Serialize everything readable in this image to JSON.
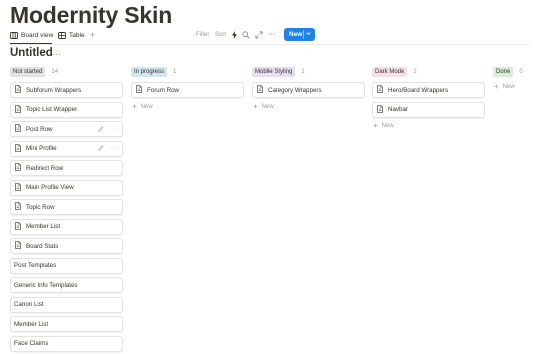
{
  "page": {
    "title": "Modernity Skin"
  },
  "toolbar": {
    "tabs": [
      {
        "label": "Board view",
        "active": true
      },
      {
        "label": "Table",
        "active": false
      }
    ],
    "add_tab": "+",
    "filter_label": "Filter",
    "sort_label": "Sort",
    "more_label": "···",
    "new_label": "New"
  },
  "view": {
    "title": "Untitled",
    "more": "···"
  },
  "colors": {
    "accent": "#2383e2",
    "not_started_bg": "#e3e2e0",
    "in_progress_bg": "#d3e5ef",
    "mobile_styling_bg": "#e8deee",
    "dark_mode_bg": "#f5e0e9",
    "done_bg": "#dbeddb"
  },
  "board": {
    "add_new_label": "New",
    "columns": [
      {
        "name": "Not started",
        "count": "14",
        "color": "#e3e2e0",
        "cards": [
          {
            "title": "Subforum Wrappers",
            "icon": "page-icon"
          },
          {
            "title": "Topic List Wrapper",
            "icon": "page-icon"
          },
          {
            "title": "Post Row",
            "icon": "page-icon",
            "hover": true
          },
          {
            "title": "Mini Profile",
            "icon": "page-icon",
            "hover": true
          },
          {
            "title": "Redirect Row",
            "icon": "page-icon"
          },
          {
            "title": "Main Profile View",
            "icon": "page-icon"
          },
          {
            "title": "Topic Row",
            "icon": "page-icon"
          },
          {
            "title": "Member List",
            "icon": "page-icon"
          },
          {
            "title": "Board Stats",
            "icon": "page-icon"
          },
          {
            "title": "Post Templates",
            "icon": ""
          },
          {
            "title": "Generic Info Templates",
            "icon": ""
          },
          {
            "title": "Canon List",
            "icon": ""
          },
          {
            "title": "Member List",
            "icon": ""
          },
          {
            "title": "Face Claims",
            "icon": ""
          }
        ]
      },
      {
        "name": "In progress",
        "count": "1",
        "color": "#d3e5ef",
        "cards": [
          {
            "title": "Forum Row",
            "icon": "page-icon"
          }
        ]
      },
      {
        "name": "Mobile Styling",
        "count": "1",
        "color": "#e8deee",
        "cards": [
          {
            "title": "Category Wrappers",
            "icon": "page-icon"
          }
        ]
      },
      {
        "name": "Dark Mode",
        "count": "2",
        "color": "#f5e0e9",
        "cards": [
          {
            "title": "Hero/Board Wrappers",
            "icon": "page-icon"
          },
          {
            "title": "Navbar",
            "icon": "page-icon"
          }
        ]
      },
      {
        "name": "Done",
        "count": "0",
        "color": "#dbeddb",
        "cards": []
      }
    ]
  }
}
